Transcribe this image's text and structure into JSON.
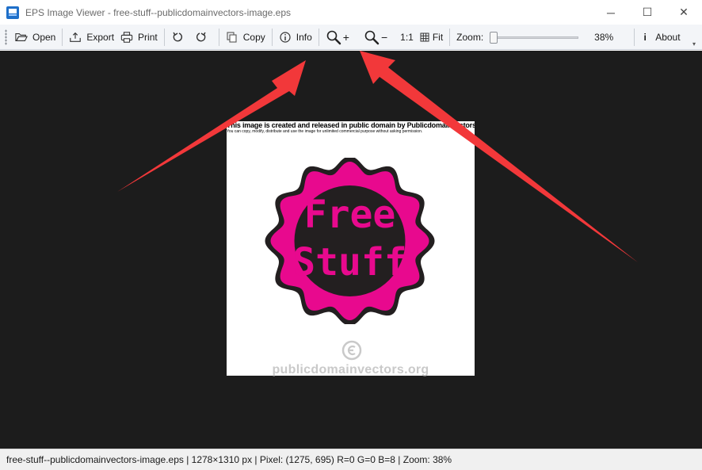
{
  "window": {
    "title": "EPS Image Viewer - free-stuff--publicdomainvectors-image.eps",
    "icon": "eps-app-icon",
    "controls": {
      "minimize": "─",
      "maximize": "☐",
      "close": "✕"
    }
  },
  "toolbar": {
    "open_label": "Open",
    "export_label": "Export",
    "print_label": "Print",
    "rotate_left_icon": "rotate-ccw-icon",
    "rotate_right_icon": "rotate-cw-icon",
    "copy_label": "Copy",
    "info_label": "Info",
    "zoom_in_label": "+",
    "zoom_out_label": "−",
    "one_to_one_label": "1:1",
    "fit_label": "Fit",
    "zoom_label": "Zoom:",
    "zoom_value": "38%",
    "zoom_fraction": 0.0,
    "about_label": "About",
    "about_icon_glyph": "i"
  },
  "document": {
    "header_line1": "This image is created and released in public domain by Publicdomainvectors.org",
    "header_line2": "You can copy, modify, distribute and use the image for unlimited commercial purpose without asking permission.",
    "seal_text_line1": "Free",
    "seal_text_line2": "Stuff",
    "watermark": "publicdomainvectors.org",
    "colors": {
      "seal_pink": "#e8098e",
      "seal_dark": "#231f20",
      "canvas_bg": "#1c1c1c",
      "arrow_red": "#f2383a"
    }
  },
  "status": {
    "text": "free-stuff--publicdomainvectors-image.eps | 1278×1310 px | Pixel: (1275, 695) R=0 G=0 B=8 | Zoom: 38%"
  }
}
